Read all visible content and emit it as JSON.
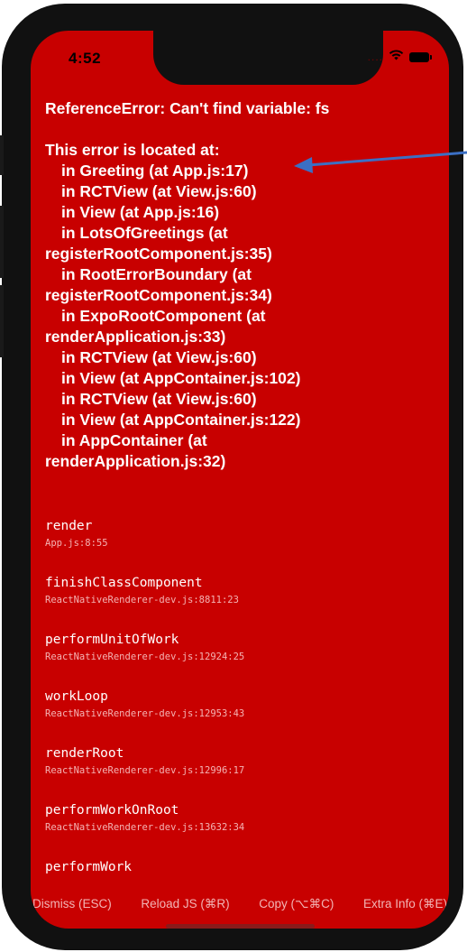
{
  "status_bar": {
    "time": "4:52",
    "signal": "....",
    "wifi_icon": "wifi-icon",
    "battery_icon": "battery-icon"
  },
  "error": {
    "title": "ReferenceError: Can't find variable: fs",
    "located_header": "This error is located at:",
    "stack_lines": [
      {
        "text": "in Greeting (at App.js:17)",
        "indent": true
      },
      {
        "text": "in RCTView (at View.js:60)",
        "indent": true
      },
      {
        "text": "in View (at App.js:16)",
        "indent": true
      },
      {
        "text": "in LotsOfGreetings (at",
        "indent": true
      },
      {
        "text": "registerRootComponent.js:35)",
        "indent": false
      },
      {
        "text": "in RootErrorBoundary (at",
        "indent": true
      },
      {
        "text": "registerRootComponent.js:34)",
        "indent": false
      },
      {
        "text": "in ExpoRootComponent (at",
        "indent": true
      },
      {
        "text": "renderApplication.js:33)",
        "indent": false
      },
      {
        "text": "in RCTView (at View.js:60)",
        "indent": true
      },
      {
        "text": "in View (at AppContainer.js:102)",
        "indent": true
      },
      {
        "text": "in RCTView (at View.js:60)",
        "indent": true
      },
      {
        "text": "in View (at AppContainer.js:122)",
        "indent": true
      },
      {
        "text": "in AppContainer (at",
        "indent": true
      },
      {
        "text": "renderApplication.js:32)",
        "indent": false
      }
    ]
  },
  "frames": [
    {
      "name": "render",
      "location": "App.js:8:55"
    },
    {
      "name": "finishClassComponent",
      "location": "ReactNativeRenderer-dev.js:8811:23"
    },
    {
      "name": "performUnitOfWork",
      "location": "ReactNativeRenderer-dev.js:12924:25"
    },
    {
      "name": "workLoop",
      "location": "ReactNativeRenderer-dev.js:12953:43"
    },
    {
      "name": "renderRoot",
      "location": "ReactNativeRenderer-dev.js:12996:17"
    },
    {
      "name": "performWorkOnRoot",
      "location": "ReactNativeRenderer-dev.js:13632:34"
    },
    {
      "name": "performWork",
      "location": ""
    }
  ],
  "bottom_bar": {
    "dismiss": "Dismiss (ESC)",
    "reload": "Reload JS (⌘R)",
    "copy": "Copy (⌥⌘C)",
    "extra_info": "Extra Info (⌘E)"
  },
  "colors": {
    "error_background": "#c80000",
    "frame_border": "#111111",
    "annotation_arrow": "#3b6fc4"
  }
}
